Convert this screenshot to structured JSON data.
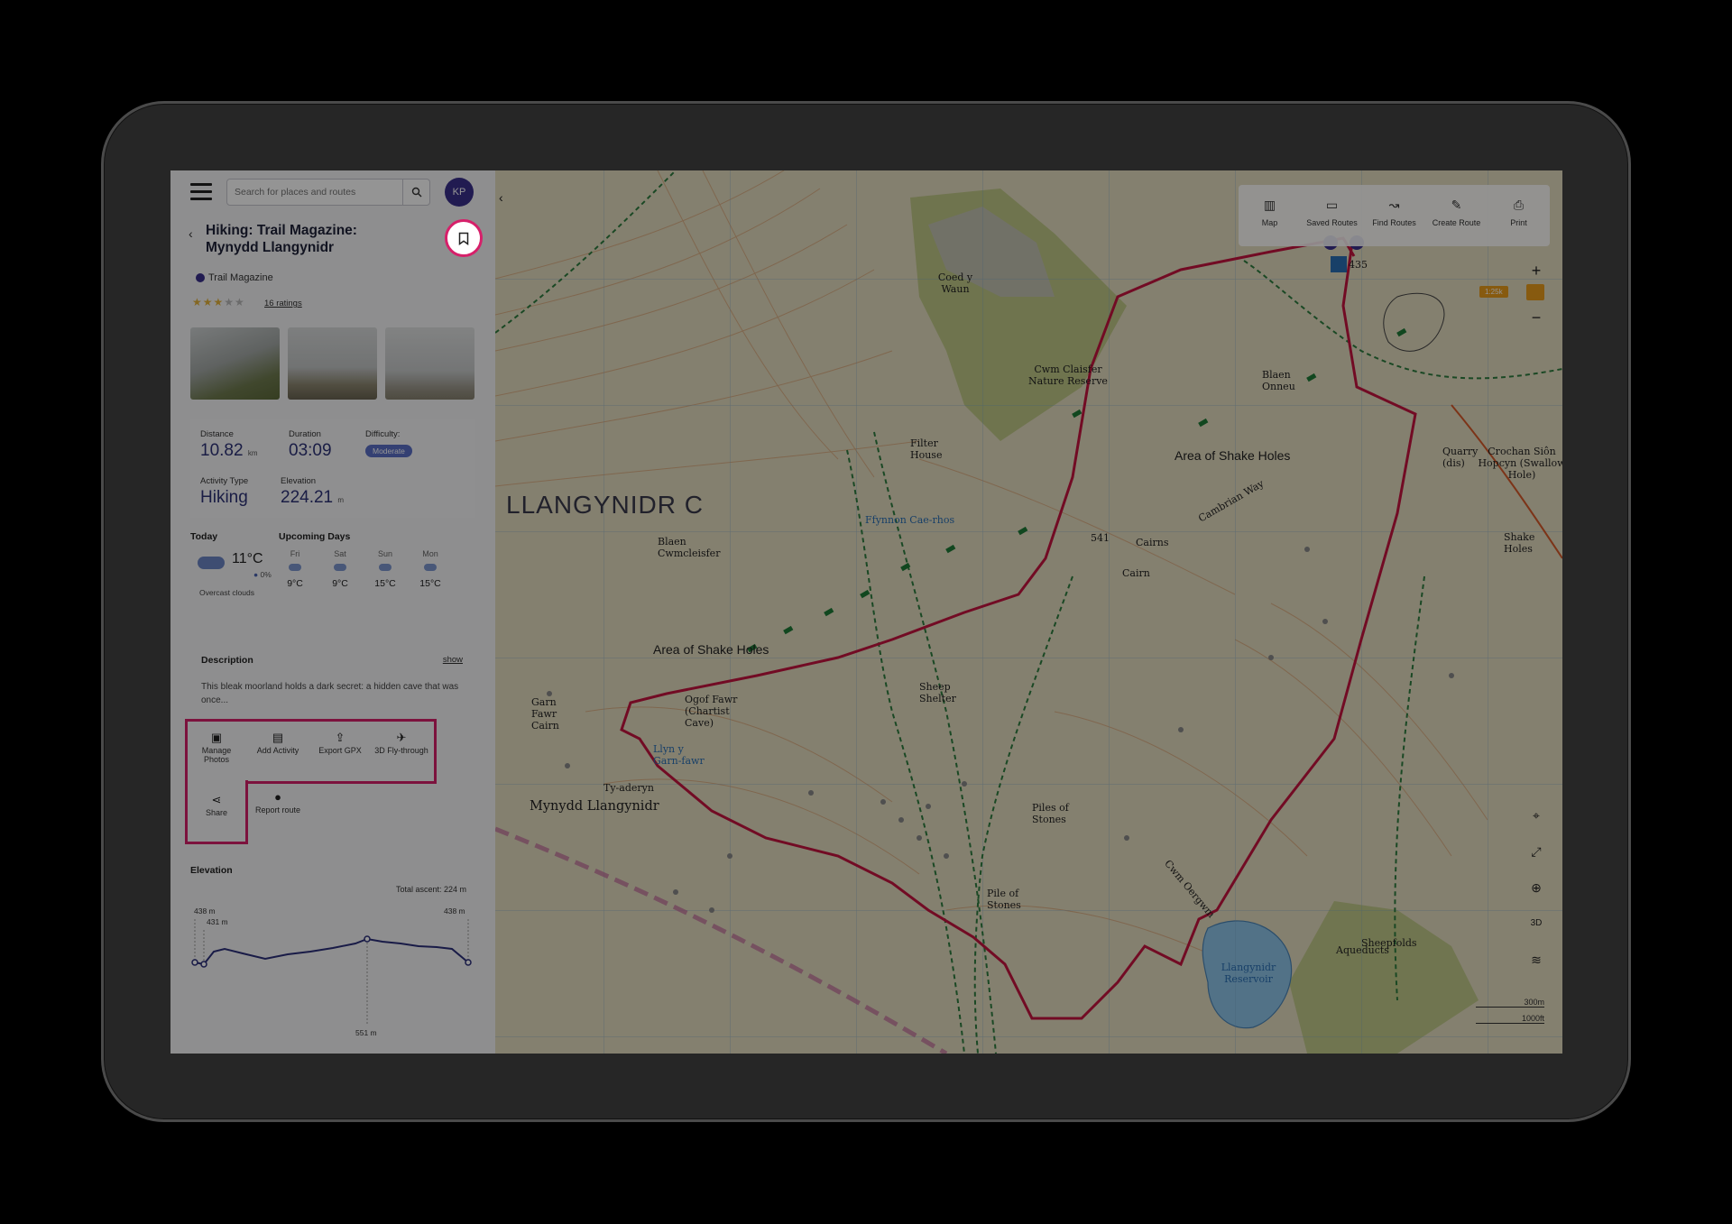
{
  "header": {
    "search_placeholder": "Search for places and routes",
    "avatar_initials": "KP"
  },
  "route": {
    "title": "Hiking: Trail Magazine: Mynydd Llangynidr",
    "author": "Trail Magazine",
    "rating_stars": 3,
    "ratings_link": "16 ratings"
  },
  "stats": {
    "distance_label": "Distance",
    "distance_value": "10.82",
    "distance_unit": "km",
    "duration_label": "Duration",
    "duration_value": "03:09",
    "difficulty_label": "Difficulty:",
    "difficulty_value": "Moderate",
    "activity_label": "Activity Type",
    "activity_value": "Hiking",
    "elevation_label": "Elevation",
    "elevation_value": "224.21",
    "elevation_unit": "m"
  },
  "weather": {
    "today_label": "Today",
    "upcoming_label": "Upcoming Days",
    "today_temp": "11°C",
    "today_precip": "0%",
    "today_desc": "Overcast clouds",
    "days": [
      {
        "day": "Fri",
        "temp": "9°C"
      },
      {
        "day": "Sat",
        "temp": "9°C"
      },
      {
        "day": "Sun",
        "temp": "15°C"
      },
      {
        "day": "Mon",
        "temp": "15°C"
      }
    ]
  },
  "description": {
    "heading": "Description",
    "show_link": "show",
    "text": "This bleak moorland holds a dark secret: a hidden cave that was once..."
  },
  "actions": {
    "manage_photos": "Manage Photos",
    "add_activity": "Add Activity",
    "export_gpx": "Export GPX",
    "flythrough": "3D Fly-through",
    "share": "Share",
    "report": "Report route"
  },
  "elevation_chart": {
    "heading": "Elevation",
    "total_ascent": "Total ascent: 224 m",
    "start_label": "438 m",
    "low_label": "431 m",
    "end_label": "438 m",
    "peak_label": "551 m"
  },
  "map_toolbar": {
    "map": "Map",
    "saved_routes": "Saved Routes",
    "find_routes": "Find Routes",
    "create_route": "Create Route",
    "print": "Print"
  },
  "map": {
    "scale_chip": "1:25k",
    "scale_m": "300m",
    "scale_ft": "1000ft",
    "labels": {
      "region": "LLANGYNIDR C",
      "shake_holes_1": "Area of Shake Holes",
      "shake_holes_2": "Area of Shake Holes",
      "mynydd": "Mynydd Llangynidr",
      "cwm_claisfer": "Cwm Claisfer Nature Reserve",
      "coed": "Coed y Waun",
      "reservoir": "Llangynidr Reservoir",
      "llyn": "Llyn y Garn-fawr",
      "ogof": "Ogof Fawr (Chartist Cave)",
      "filter": "Filter House",
      "cairns": "Cairns",
      "cairn": "Cairn",
      "piles": "Piles of Stones",
      "pile": "Pile of Stones",
      "blaen_onneu": "Blaen Onneu",
      "quarry": "Quarry (dis)",
      "crochan": "Crochan Siôn Hopcyn (Swallow Hole)",
      "shake_holes_small": "Shake Holes",
      "sheepfolds": "Sheepfolds",
      "aqueducts": "Aqueducts",
      "cambrian": "Cambrian Way",
      "ffynnon": "Ffynnon Cae-rhos",
      "garn_fawr": "Garn Fawr Cairn",
      "blaen_cwm": "Blaen Cwmcleisfer",
      "sheep_shelter": "Sheep Shelter",
      "cwm_oergwm": "Cwm Oergwm",
      "height_541": "541",
      "height_435": "435",
      "ty_aderyn": "Ty-aderyn"
    }
  }
}
